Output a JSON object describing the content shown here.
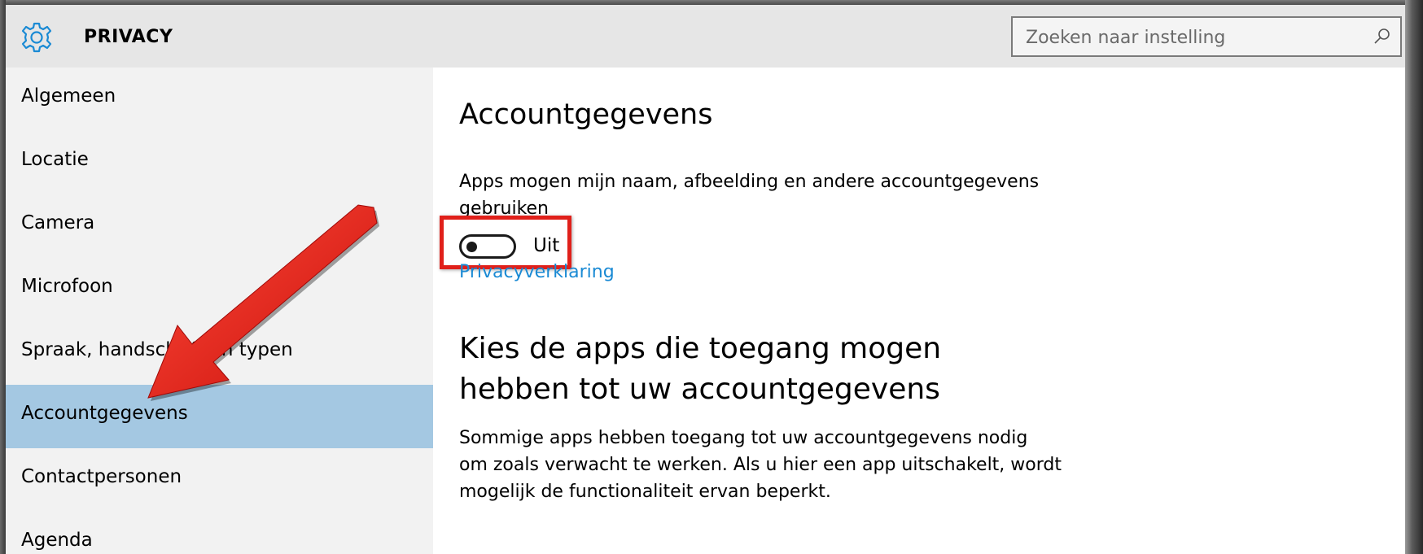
{
  "header": {
    "title": "PRIVACY",
    "search_placeholder": "Zoeken naar instelling"
  },
  "sidebar": {
    "items": [
      {
        "label": "Algemeen",
        "selected": false
      },
      {
        "label": "Locatie",
        "selected": false
      },
      {
        "label": "Camera",
        "selected": false
      },
      {
        "label": "Microfoon",
        "selected": false
      },
      {
        "label": "Spraak, handschrift en typen",
        "selected": false
      },
      {
        "label": "Accountgegevens",
        "selected": true
      },
      {
        "label": "Contactpersonen",
        "selected": false
      },
      {
        "label": "Agenda",
        "selected": false
      }
    ]
  },
  "main": {
    "title": "Accountgegevens",
    "description": "Apps mogen mijn naam, afbeelding en andere accountgegevens gebruiken",
    "toggle": {
      "label": "Uit",
      "state": "off"
    },
    "privacy_link": "Privacyverklaring",
    "apps_title": "Kies de apps die toegang mogen hebben tot uw accountgegevens",
    "apps_description": "Sommige apps hebben toegang tot uw accountgegevens nodig om zoals verwacht te werken. Als u hier een app uitschakelt, wordt mogelijk de functionaliteit ervan beperkt."
  },
  "colors": {
    "accent": "#1a8ad4",
    "selected_bg": "#a4c8e2",
    "highlight_red": "#e0201a"
  },
  "icons": {
    "header": "gear-icon",
    "search": "search-icon"
  }
}
